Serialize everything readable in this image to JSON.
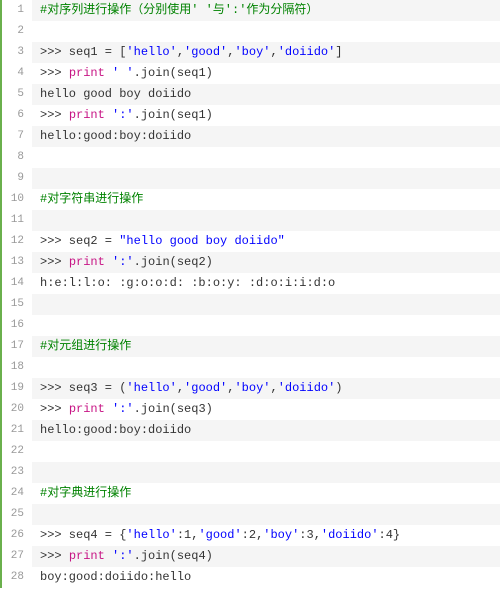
{
  "code": {
    "lines": [
      {
        "n": 1,
        "alt": true,
        "segs": [
          {
            "cls": "comment",
            "t": "#对序列进行操作（分别使用' '与':'作为分隔符）"
          }
        ]
      },
      {
        "n": 2,
        "alt": false,
        "segs": []
      },
      {
        "n": 3,
        "alt": true,
        "segs": [
          {
            "cls": "plain",
            "t": ">>> seq1 = ["
          },
          {
            "cls": "string",
            "t": "'hello'"
          },
          {
            "cls": "plain",
            "t": ","
          },
          {
            "cls": "string",
            "t": "'good'"
          },
          {
            "cls": "plain",
            "t": ","
          },
          {
            "cls": "string",
            "t": "'boy'"
          },
          {
            "cls": "plain",
            "t": ","
          },
          {
            "cls": "string",
            "t": "'doiido'"
          },
          {
            "cls": "plain",
            "t": "]"
          }
        ]
      },
      {
        "n": 4,
        "alt": false,
        "segs": [
          {
            "cls": "plain",
            "t": ">>> "
          },
          {
            "cls": "keyword",
            "t": "print"
          },
          {
            "cls": "plain",
            "t": " "
          },
          {
            "cls": "string",
            "t": "' '"
          },
          {
            "cls": "plain",
            "t": ".join(seq1)"
          }
        ]
      },
      {
        "n": 5,
        "alt": true,
        "segs": [
          {
            "cls": "plain",
            "t": "hello good boy doiido"
          }
        ]
      },
      {
        "n": 6,
        "alt": false,
        "segs": [
          {
            "cls": "plain",
            "t": ">>> "
          },
          {
            "cls": "keyword",
            "t": "print"
          },
          {
            "cls": "plain",
            "t": " "
          },
          {
            "cls": "string",
            "t": "':'"
          },
          {
            "cls": "plain",
            "t": ".join(seq1)"
          }
        ]
      },
      {
        "n": 7,
        "alt": true,
        "segs": [
          {
            "cls": "plain",
            "t": "hello:good:boy:doiido"
          }
        ]
      },
      {
        "n": 8,
        "alt": false,
        "segs": []
      },
      {
        "n": 9,
        "alt": true,
        "segs": []
      },
      {
        "n": 10,
        "alt": false,
        "segs": [
          {
            "cls": "comment",
            "t": "#对字符串进行操作"
          }
        ]
      },
      {
        "n": 11,
        "alt": true,
        "segs": []
      },
      {
        "n": 12,
        "alt": false,
        "segs": [
          {
            "cls": "plain",
            "t": ">>> seq2 = "
          },
          {
            "cls": "string",
            "t": "\"hello good boy doiido\""
          }
        ]
      },
      {
        "n": 13,
        "alt": true,
        "segs": [
          {
            "cls": "plain",
            "t": ">>> "
          },
          {
            "cls": "keyword",
            "t": "print"
          },
          {
            "cls": "plain",
            "t": " "
          },
          {
            "cls": "string",
            "t": "':'"
          },
          {
            "cls": "plain",
            "t": ".join(seq2)"
          }
        ]
      },
      {
        "n": 14,
        "alt": false,
        "segs": [
          {
            "cls": "plain",
            "t": "h:e:l:l:o: :g:o:o:d: :b:o:y: :d:o:i:i:d:o"
          }
        ]
      },
      {
        "n": 15,
        "alt": true,
        "segs": []
      },
      {
        "n": 16,
        "alt": false,
        "segs": []
      },
      {
        "n": 17,
        "alt": true,
        "segs": [
          {
            "cls": "comment",
            "t": "#对元组进行操作"
          }
        ]
      },
      {
        "n": 18,
        "alt": false,
        "segs": []
      },
      {
        "n": 19,
        "alt": true,
        "segs": [
          {
            "cls": "plain",
            "t": ">>> seq3 = ("
          },
          {
            "cls": "string",
            "t": "'hello'"
          },
          {
            "cls": "plain",
            "t": ","
          },
          {
            "cls": "string",
            "t": "'good'"
          },
          {
            "cls": "plain",
            "t": ","
          },
          {
            "cls": "string",
            "t": "'boy'"
          },
          {
            "cls": "plain",
            "t": ","
          },
          {
            "cls": "string",
            "t": "'doiido'"
          },
          {
            "cls": "plain",
            "t": ")"
          }
        ]
      },
      {
        "n": 20,
        "alt": false,
        "segs": [
          {
            "cls": "plain",
            "t": ">>> "
          },
          {
            "cls": "keyword",
            "t": "print"
          },
          {
            "cls": "plain",
            "t": " "
          },
          {
            "cls": "string",
            "t": "':'"
          },
          {
            "cls": "plain",
            "t": ".join(seq3)"
          }
        ]
      },
      {
        "n": 21,
        "alt": true,
        "segs": [
          {
            "cls": "plain",
            "t": "hello:good:boy:doiido"
          }
        ]
      },
      {
        "n": 22,
        "alt": false,
        "segs": []
      },
      {
        "n": 23,
        "alt": true,
        "segs": []
      },
      {
        "n": 24,
        "alt": false,
        "segs": [
          {
            "cls": "comment",
            "t": "#对字典进行操作"
          }
        ]
      },
      {
        "n": 25,
        "alt": true,
        "segs": []
      },
      {
        "n": 26,
        "alt": false,
        "segs": [
          {
            "cls": "plain",
            "t": ">>> seq4 = {"
          },
          {
            "cls": "string",
            "t": "'hello'"
          },
          {
            "cls": "plain",
            "t": ":1,"
          },
          {
            "cls": "string",
            "t": "'good'"
          },
          {
            "cls": "plain",
            "t": ":2,"
          },
          {
            "cls": "string",
            "t": "'boy'"
          },
          {
            "cls": "plain",
            "t": ":3,"
          },
          {
            "cls": "string",
            "t": "'doiido'"
          },
          {
            "cls": "plain",
            "t": ":4}"
          }
        ]
      },
      {
        "n": 27,
        "alt": true,
        "segs": [
          {
            "cls": "plain",
            "t": ">>> "
          },
          {
            "cls": "keyword",
            "t": "print"
          },
          {
            "cls": "plain",
            "t": " "
          },
          {
            "cls": "string",
            "t": "':'"
          },
          {
            "cls": "plain",
            "t": ".join(seq4)"
          }
        ]
      },
      {
        "n": 28,
        "alt": false,
        "segs": [
          {
            "cls": "plain",
            "t": "boy:good:doiido:hello"
          }
        ]
      }
    ]
  }
}
